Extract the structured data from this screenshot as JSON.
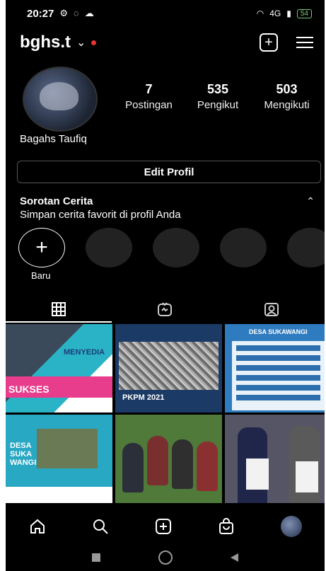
{
  "status": {
    "time": "20:27",
    "net": "4G",
    "battery": "54"
  },
  "profile": {
    "username": "bghs.t",
    "display_name": "Bagahs Taufiq",
    "stats": [
      {
        "value": "7",
        "label": "Postingan"
      },
      {
        "value": "535",
        "label": "Pengikut"
      },
      {
        "value": "503",
        "label": "Mengikuti"
      }
    ],
    "edit_label": "Edit Profil"
  },
  "highlights": {
    "title": "Sorotan Cerita",
    "subtitle": "Simpan cerita favorit di profil Anda",
    "new_label": "Baru"
  },
  "posts": {
    "p1_caption1": "MENYEDIA",
    "p1_caption2": "SUKSES",
    "p2_caption": "PKPM 2021",
    "p3_caption": "DESA SUKAWANGI",
    "p4_caption": "DESA SUKA WANGI"
  },
  "icons": [
    "chevron-down-icon",
    "add-icon",
    "menu-icon",
    "grid-icon",
    "reels-icon",
    "tagged-icon",
    "home-icon",
    "search-icon",
    "create-icon",
    "shop-icon",
    "profile-avatar"
  ],
  "colors": {
    "background": "#000000",
    "notification_dot": "#e33333"
  }
}
